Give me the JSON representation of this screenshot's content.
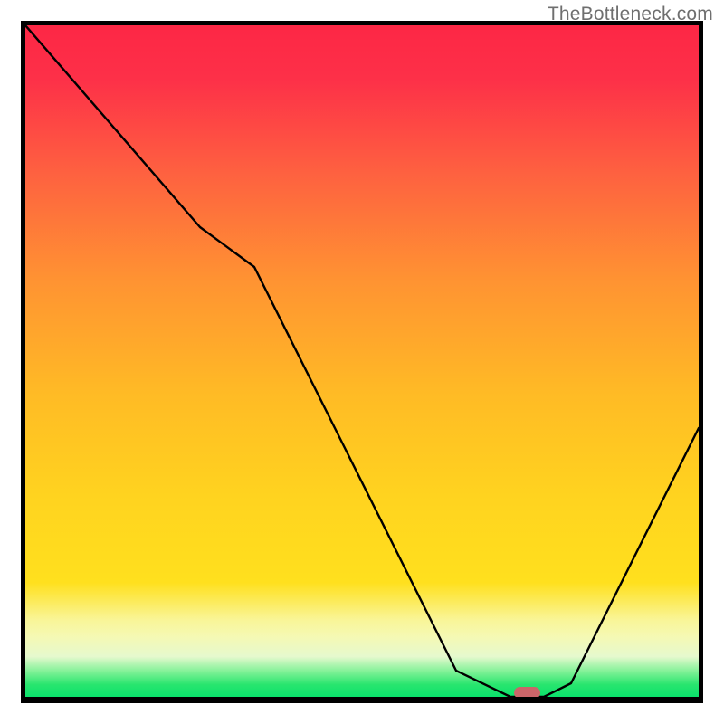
{
  "watermark": {
    "text": "TheBottleneck.com"
  },
  "chart_data": {
    "type": "line",
    "title": "",
    "xlabel": "",
    "ylabel": "",
    "x": [
      0.0,
      0.26,
      0.34,
      0.64,
      0.72,
      0.77,
      0.81,
      1.0
    ],
    "values": [
      1.0,
      0.7,
      0.64,
      0.04,
      0.0,
      0.0,
      0.02,
      0.4
    ],
    "xlim": [
      0,
      1
    ],
    "ylim": [
      0,
      1
    ],
    "optimal_marker": {
      "x": 0.745,
      "y": 0.0
    },
    "gradient_bands": [
      {
        "y": 1.0,
        "color": "#fd2745"
      },
      {
        "y": 0.17,
        "color": "#ffde1d"
      },
      {
        "y": 0.115,
        "color": "#f9f597"
      },
      {
        "y": 0.06,
        "color": "#f2fac1"
      },
      {
        "y": 0.037,
        "color": "#7df195"
      },
      {
        "y": 0.018,
        "color": "#28e56e"
      },
      {
        "y": 0.0,
        "color": "#0ae36c"
      }
    ],
    "marker_color": "#cb6569"
  }
}
